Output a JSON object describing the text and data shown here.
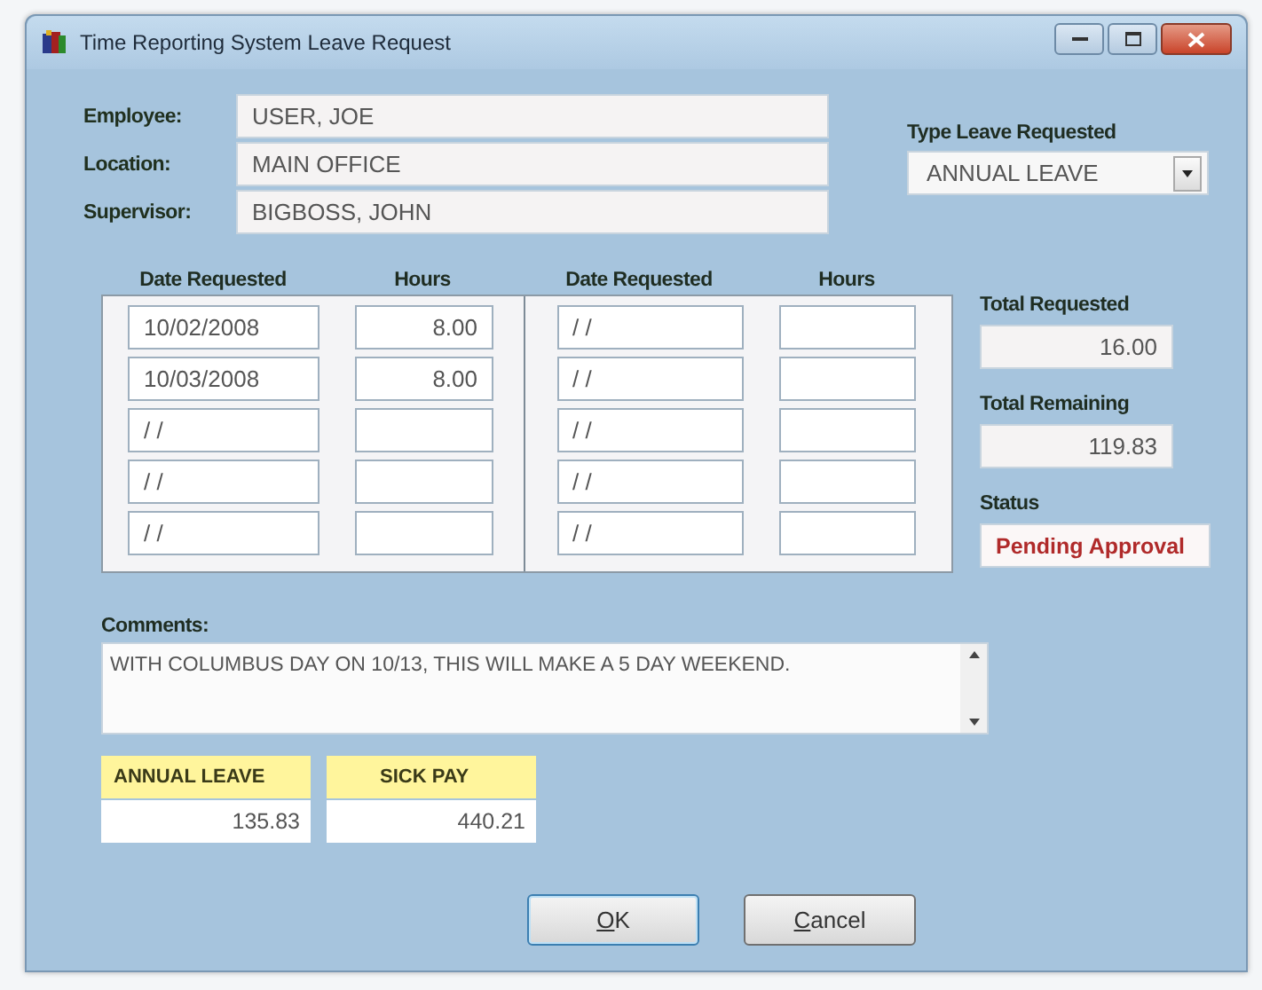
{
  "window": {
    "title": "Time Reporting System Leave Request"
  },
  "employee_info": [
    {
      "label": "Employee:",
      "value": "USER, JOE"
    },
    {
      "label": "Location:",
      "value": "MAIN OFFICE"
    },
    {
      "label": "Supervisor:",
      "value": "BIGBOSS, JOHN"
    }
  ],
  "leave_type": {
    "label": "Type Leave Requested",
    "value": "ANNUAL LEAVE"
  },
  "request_table": {
    "columns": [
      "Date Requested",
      "Hours",
      "Date Requested",
      "Hours"
    ],
    "left_rows": [
      {
        "date": "10/02/2008",
        "hours": "8.00"
      },
      {
        "date": "10/03/2008",
        "hours": "8.00"
      },
      {
        "date": "/ /"
      },
      {
        "date": "/ /"
      },
      {
        "date": "/ /"
      }
    ],
    "right_rows": [
      {
        "date": "/ /"
      },
      {
        "date": "/ /"
      },
      {
        "date": "/ /"
      },
      {
        "date": "/ /"
      },
      {
        "date": "/ /"
      }
    ]
  },
  "totals": [
    {
      "label": "Total Requested",
      "value": "16.00"
    },
    {
      "label": "Total Remaining",
      "value": "119.83"
    }
  ],
  "status": {
    "label": "Status",
    "value": "Pending Approval"
  },
  "comments": {
    "label": "Comments:",
    "value": "WITH COLUMBUS DAY ON 10/13, THIS WILL MAKE A 5 DAY WEEKEND."
  },
  "balances": [
    {
      "label": "ANNUAL LEAVE",
      "value": "135.83"
    },
    {
      "label": "SICK PAY",
      "value": "440.21"
    }
  ],
  "buttons": [
    {
      "label": "OK",
      "default": true
    },
    {
      "label": "Cancel",
      "default": false
    }
  ]
}
